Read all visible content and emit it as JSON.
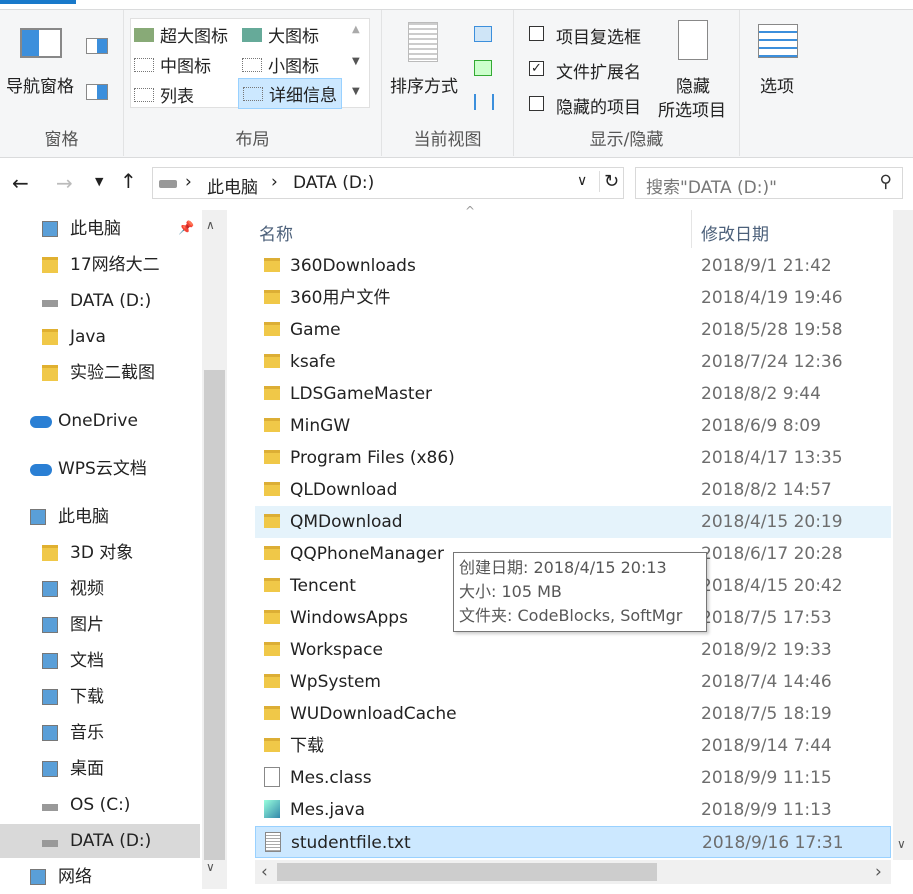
{
  "ribbon": {
    "pane": {
      "nav_pane": "导航窗格",
      "group": "窗格"
    },
    "layout": {
      "items": [
        "超大图标",
        "大图标",
        "中图标",
        "小图标",
        "列表",
        "详细信息"
      ],
      "selected": "详细信息",
      "group": "布局"
    },
    "current_view": {
      "sort": "排序方式",
      "group": "当前视图"
    },
    "show_hide": {
      "item_checkboxes": {
        "label": "项目复选框",
        "checked": false
      },
      "file_extensions": {
        "label": "文件扩展名",
        "checked": true
      },
      "hidden_items": {
        "label": "隐藏的项目",
        "checked": false
      },
      "hide_selected_1": "隐藏",
      "hide_selected_2": "所选项目",
      "group": "显示/隐藏"
    },
    "options": "选项"
  },
  "address": {
    "path": [
      "此电脑",
      "DATA (D:)"
    ],
    "search_placeholder": "搜索\"DATA (D:)\""
  },
  "nav": [
    {
      "label": "此电脑",
      "icon": "pc-icon",
      "pinned": true
    },
    {
      "label": "17网络大二",
      "icon": "folder-icon"
    },
    {
      "label": "DATA (D:)",
      "icon": "drive-icon"
    },
    {
      "label": "Java",
      "icon": "folder-icon"
    },
    {
      "label": "实验二截图",
      "icon": "folder-icon"
    },
    {
      "label": "OneDrive",
      "icon": "cloud-icon"
    },
    {
      "label": "WPS云文档",
      "icon": "cloud-icon"
    },
    {
      "label": "此电脑",
      "icon": "pc-icon"
    },
    {
      "label": "3D 对象",
      "icon": "folder-icon"
    },
    {
      "label": "视频",
      "icon": "video-icon"
    },
    {
      "label": "图片",
      "icon": "picture-icon"
    },
    {
      "label": "文档",
      "icon": "document-icon"
    },
    {
      "label": "下载",
      "icon": "download-icon"
    },
    {
      "label": "音乐",
      "icon": "music-icon"
    },
    {
      "label": "桌面",
      "icon": "desktop-icon"
    },
    {
      "label": "OS (C:)",
      "icon": "drive-icon"
    },
    {
      "label": "DATA (D:)",
      "icon": "drive-icon",
      "selected": true
    },
    {
      "label": "网络",
      "icon": "network-icon"
    }
  ],
  "columns": {
    "name": "名称",
    "date": "修改日期"
  },
  "files": [
    {
      "name": "360Downloads",
      "date": "2018/9/1 21:42",
      "type": "folder"
    },
    {
      "name": "360用户文件",
      "date": "2018/4/19 19:46",
      "type": "folder"
    },
    {
      "name": "Game",
      "date": "2018/5/28 19:58",
      "type": "folder"
    },
    {
      "name": "ksafe",
      "date": "2018/7/24 12:36",
      "type": "folder"
    },
    {
      "name": "LDSGameMaster",
      "date": "2018/8/2 9:44",
      "type": "folder"
    },
    {
      "name": "MinGW",
      "date": "2018/6/9 8:09",
      "type": "folder"
    },
    {
      "name": "Program Files (x86)",
      "date": "2018/4/17 13:35",
      "type": "folder"
    },
    {
      "name": "QLDownload",
      "date": "2018/8/2 14:57",
      "type": "folder"
    },
    {
      "name": "QMDownload",
      "date": "2018/4/15 20:19",
      "type": "folder",
      "hover": true
    },
    {
      "name": "QQPhoneManager",
      "date": "2018/6/17 20:28",
      "type": "folder"
    },
    {
      "name": "Tencent",
      "date": "2018/4/15 20:42",
      "type": "folder"
    },
    {
      "name": "WindowsApps",
      "date": "2018/7/5 17:53",
      "type": "folder"
    },
    {
      "name": "Workspace",
      "date": "2018/9/2 19:33",
      "type": "folder"
    },
    {
      "name": "WpSystem",
      "date": "2018/7/4 14:46",
      "type": "folder"
    },
    {
      "name": "WUDownloadCache",
      "date": "2018/7/5 18:19",
      "type": "folder"
    },
    {
      "name": "下载",
      "date": "2018/9/14 7:44",
      "type": "folder"
    },
    {
      "name": "Mes.class",
      "date": "2018/9/9 11:15",
      "type": "file"
    },
    {
      "name": "Mes.java",
      "date": "2018/9/9 11:13",
      "type": "java"
    },
    {
      "name": "studentfile.txt",
      "date": "2018/9/16 17:31",
      "type": "text",
      "selected": true
    }
  ],
  "tooltip": [
    "创建日期: 2018/4/15 20:13",
    "大小: 105 MB",
    "文件夹: CodeBlocks, SoftMgr"
  ],
  "colors": {
    "accent": "#1979ca",
    "selected": "#cce8ff",
    "hover": "#e5f3fb",
    "folder": "#f0c848"
  }
}
